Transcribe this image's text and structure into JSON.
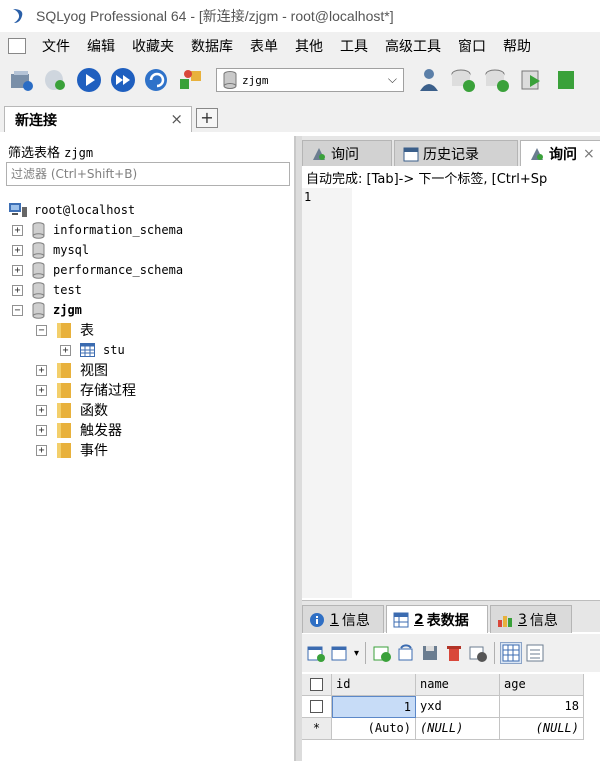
{
  "window": {
    "title": "SQLyog Professional 64 - [新连接/zjgm - root@localhost*]"
  },
  "menu": {
    "items": [
      "文件",
      "编辑",
      "收藏夹",
      "数据库",
      "表单",
      "其他",
      "工具",
      "高级工具",
      "窗口",
      "帮助"
    ]
  },
  "toolbar": {
    "database_value": "zjgm"
  },
  "connection_tab": {
    "label": "新连接",
    "close": "×",
    "add": "+"
  },
  "object_browser": {
    "filter_label": "筛选表格",
    "filter_db": "zjgm",
    "filter_placeholder": "过滤器 (Ctrl+Shift+B)",
    "root": "root@localhost",
    "databases": [
      "information_schema",
      "mysql",
      "performance_schema",
      "test",
      "zjgm"
    ],
    "expand_plus": "+",
    "expand_minus": "−",
    "tables_folder": "表",
    "table_name": "stu",
    "folders": [
      "视图",
      "存储过程",
      "函数",
      "触发器",
      "事件"
    ]
  },
  "query_tabs": [
    {
      "label": "询问"
    },
    {
      "label": "历史记录"
    },
    {
      "label": "询问",
      "close": "×"
    }
  ],
  "editor": {
    "autocomplete_hint": "自动完成: [Tab]-> 下一个标签, [Ctrl+Sp",
    "line_number": "1"
  },
  "result_tabs": [
    {
      "num": "1",
      "label": "信息"
    },
    {
      "num": "2",
      "label": "表数据"
    },
    {
      "num": "3",
      "label": "信息"
    }
  ],
  "grid": {
    "columns": [
      "id",
      "name",
      "age"
    ],
    "rows": [
      {
        "marker": "",
        "id": "1",
        "name": "yxd",
        "age": "18"
      },
      {
        "marker": "*",
        "id": "(Auto)",
        "name": "(NULL)",
        "age": "(NULL)"
      }
    ]
  },
  "colors": {
    "accent_blue": "#1f5fbf",
    "folder_yellow": "#e8b13c",
    "selection": "#c7dcf7"
  }
}
